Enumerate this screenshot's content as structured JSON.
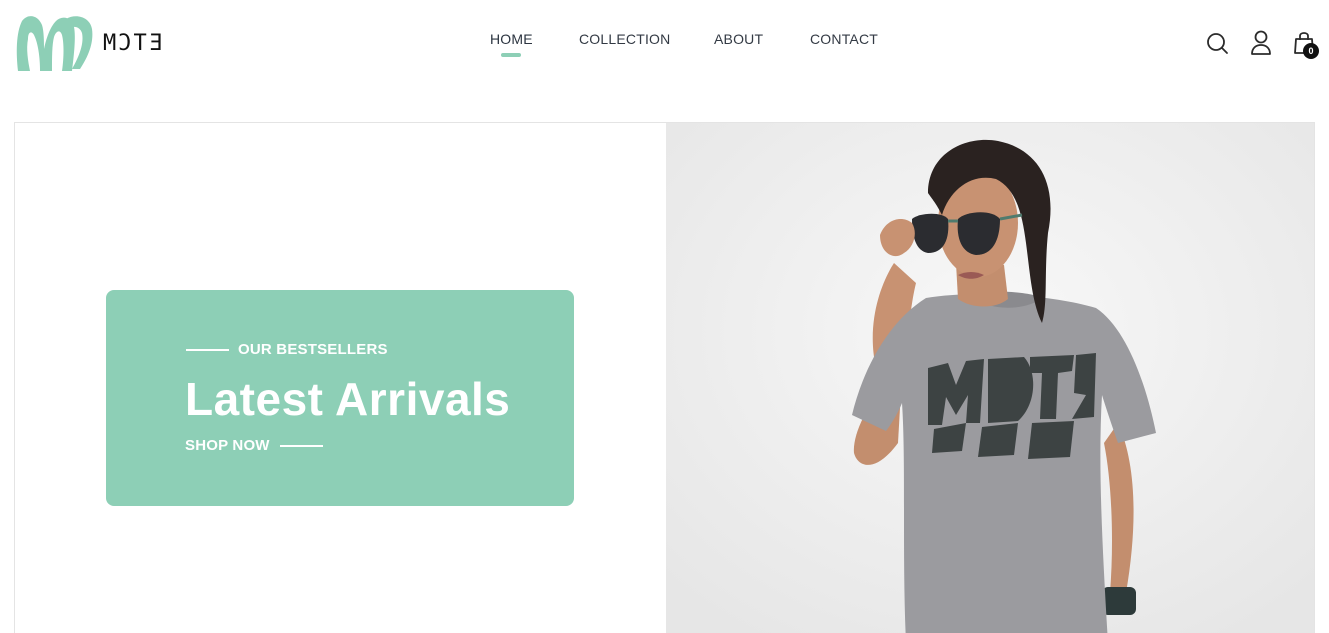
{
  "brand": {
    "name": "MƆTƎ",
    "accent_color": "#8dcfb6"
  },
  "nav": {
    "items": [
      {
        "label": "HOME",
        "active": true
      },
      {
        "label": "COLLECTION",
        "active": false
      },
      {
        "label": "ABOUT",
        "active": false
      },
      {
        "label": "CONTACT",
        "active": false
      }
    ]
  },
  "header_icons": {
    "search": "search-icon",
    "account": "user-icon",
    "cart": "shopping-bag-icon",
    "cart_count": "0"
  },
  "hero": {
    "eyebrow": "OUR BESTSELLERS",
    "title": "Latest Arrivals",
    "cta": "SHOP NOW",
    "image": "model-wearing-grey-graphic-tshirt-and-sunglasses",
    "tshirt_print": "MƆTƎ"
  }
}
